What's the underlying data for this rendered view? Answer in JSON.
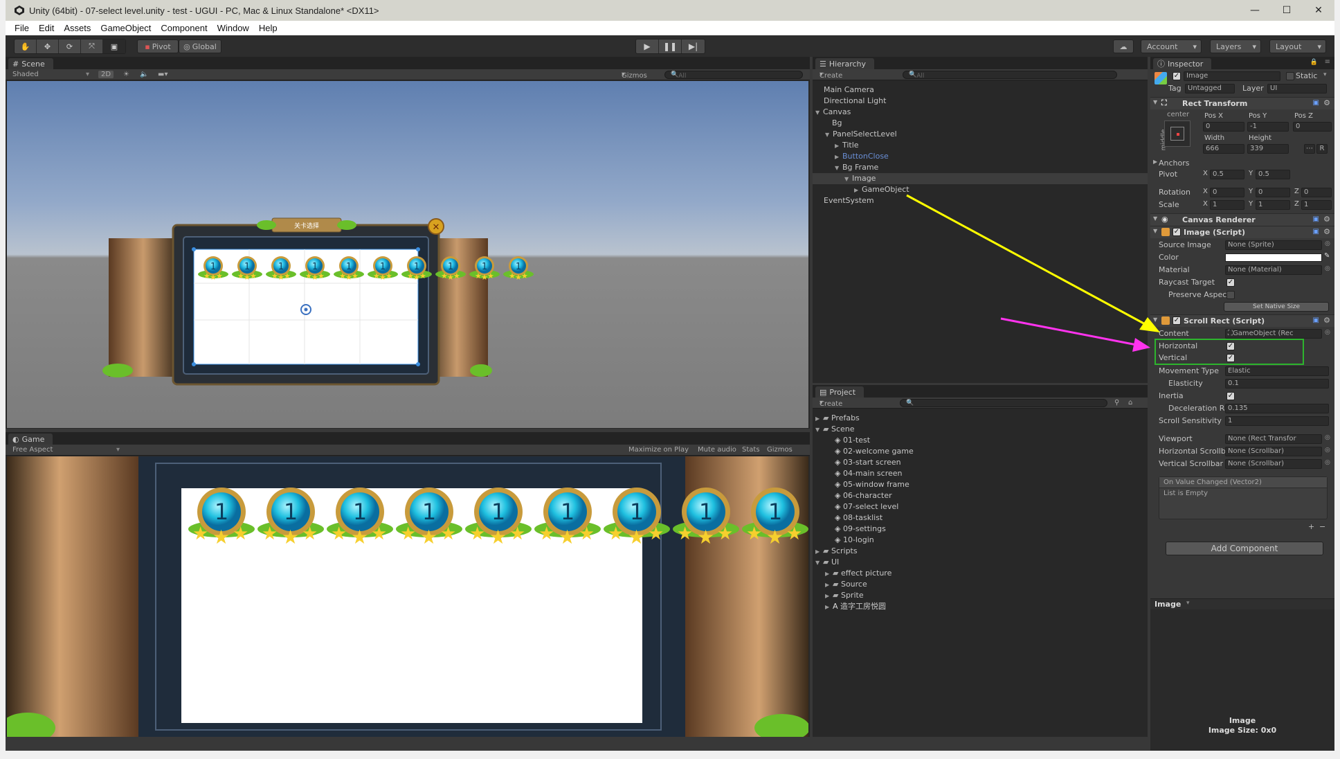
{
  "window": {
    "title": "Unity (64bit) - 07-select level.unity - test - UGUI - PC, Mac & Linux Standalone* <DX11>",
    "minimize": "—",
    "maximize": "☐",
    "close": "✕"
  },
  "menu": [
    "File",
    "Edit",
    "Assets",
    "GameObject",
    "Component",
    "Window",
    "Help"
  ],
  "toolbar": {
    "pivot": "Pivot",
    "global": "Global",
    "account": "Account",
    "layers": "Layers",
    "layout": "Layout"
  },
  "scene": {
    "tab": "Scene",
    "shading": "Shaded",
    "mode_2d": "2D",
    "gizmos": "Gizmos",
    "search_placeholder": "All",
    "banner_text": "关卡选择",
    "medal_number": "1"
  },
  "game": {
    "tab": "Game",
    "aspect": "Free Aspect",
    "maximize_on_play": "Maximize on Play",
    "mute_audio": "Mute audio",
    "stats": "Stats",
    "gizmos": "Gizmos"
  },
  "hierarchy": {
    "tab": "Hierarchy",
    "create": "Create",
    "search_placeholder": "All",
    "items": [
      {
        "label": "Main Camera"
      },
      {
        "label": "Directional Light"
      },
      {
        "label": "Canvas"
      },
      {
        "label": "Bg"
      },
      {
        "label": "PanelSelectLevel"
      },
      {
        "label": "Title"
      },
      {
        "label": "ButtonClose"
      },
      {
        "label": "Bg Frame"
      },
      {
        "label": "Image"
      },
      {
        "label": "GameObject"
      },
      {
        "label": "EventSystem"
      }
    ]
  },
  "project": {
    "tab": "Project",
    "create": "Create",
    "items": [
      {
        "label": "Prefabs"
      },
      {
        "label": "Scene"
      },
      {
        "label": "01-test"
      },
      {
        "label": "02-welcome game"
      },
      {
        "label": "03-start screen"
      },
      {
        "label": "04-main screen"
      },
      {
        "label": "05-window frame"
      },
      {
        "label": "06-character"
      },
      {
        "label": "07-select level"
      },
      {
        "label": "08-tasklist"
      },
      {
        "label": "09-settings"
      },
      {
        "label": "10-login"
      },
      {
        "label": "Scripts"
      },
      {
        "label": "UI"
      },
      {
        "label": "effect picture"
      },
      {
        "label": "Source"
      },
      {
        "label": "Sprite"
      },
      {
        "label": "造字工房悦圆"
      }
    ]
  },
  "inspector": {
    "tab": "Inspector",
    "object_name": "Image",
    "static": "Static",
    "tag_label": "Tag",
    "tag_value": "Untagged",
    "layer_label": "Layer",
    "layer_value": "UI",
    "rect_transform": {
      "title": "Rect Transform",
      "anchor_h": "center",
      "anchor_v": "middle",
      "pos_x_label": "Pos X",
      "pos_y_label": "Pos Y",
      "pos_z_label": "Pos Z",
      "pos_x": "0",
      "pos_y": "-1",
      "pos_z": "0",
      "width_label": "Width",
      "height_label": "Height",
      "width": "666",
      "height": "339",
      "anchors": "Anchors",
      "pivot": "Pivot",
      "pivot_x": "0.5",
      "pivot_y": "0.5",
      "rotation": "Rotation",
      "rot_x": "0",
      "rot_y": "0",
      "rot_z": "0",
      "scale": "Scale",
      "scale_x": "1",
      "scale_y": "1",
      "scale_z": "1",
      "x": "X",
      "y": "Y",
      "z": "Z",
      "r_button": "R"
    },
    "canvas_renderer": {
      "title": "Canvas Renderer"
    },
    "image_script": {
      "title": "Image (Script)",
      "source_image_label": "Source Image",
      "source_image": "None (Sprite)",
      "color_label": "Color",
      "material_label": "Material",
      "material": "None (Material)",
      "raycast_label": "Raycast Target",
      "preserve_label": "Preserve Aspect",
      "native_size": "Set Native Size"
    },
    "scroll_rect": {
      "title": "Scroll Rect (Script)",
      "content_label": "Content",
      "content": "GameObject (Rec",
      "horizontal_label": "Horizontal",
      "vertical_label": "Vertical",
      "movement_label": "Movement Type",
      "movement": "Elastic",
      "elasticity_label": "Elasticity",
      "elasticity": "0.1",
      "inertia_label": "Inertia",
      "decel_label": "Deceleration Rate",
      "decel": "0.135",
      "sensitivity_label": "Scroll Sensitivity",
      "sensitivity": "1",
      "viewport_label": "Viewport",
      "viewport": "None (Rect Transfor",
      "hscroll_label": "Horizontal Scrollbar",
      "hscroll": "None (Scrollbar)",
      "vscroll_label": "Vertical Scrollbar",
      "vscroll": "None (Scrollbar)",
      "event_title": "On Value Changed (Vector2)",
      "event_empty": "List is Empty",
      "plus": "+",
      "minus": "−"
    },
    "add_component": "Add Component",
    "preview_title": "Image",
    "preview_name": "Image",
    "preview_size": "Image Size: 0x0"
  },
  "colors": {
    "annotation_yellow": "#ffff00",
    "annotation_magenta": "#ff33ee",
    "highlight_green": "#2db52d",
    "medal_cyan": "#1fc0e0",
    "medal_gold": "#c89b3c",
    "leaf_green": "#6abf2a"
  }
}
